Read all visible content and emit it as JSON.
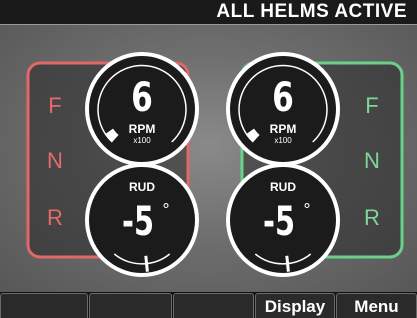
{
  "status": {
    "text": "ALL HELMS ACTIVE"
  },
  "colors": {
    "port_frame": "#e26868",
    "stbd_frame": "#6cd08a",
    "gear_inactive_port": "#e56a6a",
    "gear_inactive_stbd": "#7fd69a"
  },
  "port": {
    "gear_labels": [
      "F",
      "N",
      "R"
    ],
    "rpm": {
      "value": "6",
      "label": "RPM",
      "unit": "x100",
      "level": 0.05
    },
    "rudder": {
      "label": "RUD",
      "value": "-5",
      "unit": "°",
      "angle": -5
    }
  },
  "starboard": {
    "gear_labels": [
      "F",
      "N",
      "R"
    ],
    "rpm": {
      "value": "6",
      "label": "RPM",
      "unit": "x100",
      "level": 0.05
    },
    "rudder": {
      "label": "RUD",
      "value": "-5",
      "unit": "°",
      "angle": -5
    }
  },
  "softkeys": [
    "",
    "",
    "",
    "Display",
    "Menu"
  ]
}
